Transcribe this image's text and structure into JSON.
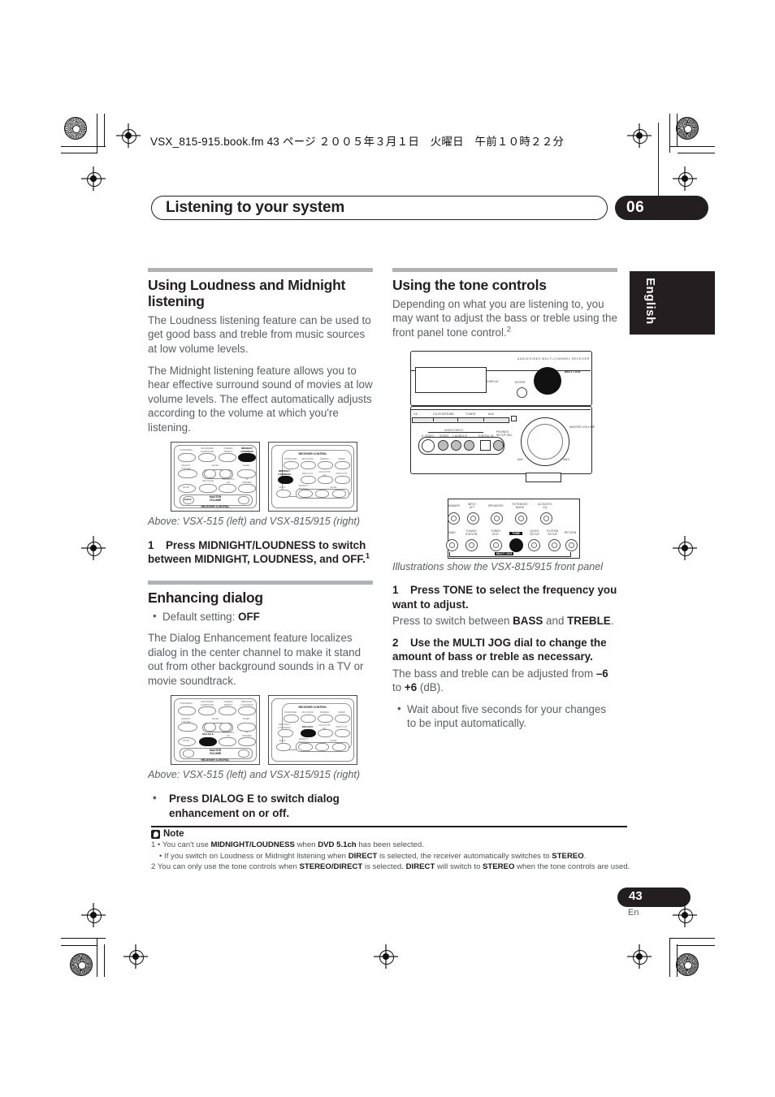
{
  "print_header": {
    "filename_line": "VSX_815-915.book.fm  43 ページ  ２００５年３月１日　火曜日　午前１０時２２分"
  },
  "chapter": {
    "title": "Listening to your system",
    "number": "06"
  },
  "language_tab": "English",
  "left_column": {
    "section1": {
      "heading": "Using Loudness and Midnight listening",
      "paragraphs": [
        "The Loudness listening feature can be used to get good bass and treble from music sources at low volume levels.",
        "The Midnight listening feature allows you to hear effective surround sound of movies at low volume levels. The effect automatically adjusts according to the volume at which you're listening."
      ],
      "figure_caption": "Above: VSX-515 (left) and VSX-815/915 (right)",
      "step_number": "1",
      "step_text_a": "Press MIDNIGHT/LOUDNESS to switch between MIDNIGHT, LOUDNESS, and OFF.",
      "step_footnote": "1"
    },
    "section2": {
      "heading": "Enhancing dialog",
      "bullet_default": "Default setting: ",
      "bullet_default_value": "OFF",
      "paragraph": "The Dialog Enhancement feature localizes dialog in the center channel to make it stand out from other background sounds in a TV or movie soundtrack.",
      "figure_caption": "Above: VSX-515 (left) and VSX-815/915 (right)",
      "bullet_step": "Press DIALOG E to switch dialog enhancement on or off."
    }
  },
  "right_column": {
    "section": {
      "heading": "Using the tone controls",
      "intro_a": "Depending on what you are listening to, you may want to adjust the bass or treble using the front panel tone control.",
      "intro_footnote": "2",
      "figure_caption": "Illustrations show the VSX-815/915 front panel",
      "step1_number": "1",
      "step1_text": "Press TONE to select the frequency you want to adjust.",
      "step1_body_a": "Press to switch between ",
      "step1_body_bold1": "BASS",
      "step1_body_b": " and ",
      "step1_body_bold2": "TREBLE",
      "step1_body_c": ".",
      "step2_number": "2",
      "step2_text": "Use the MULTI JOG dial to change the amount of bass or treble as necessary.",
      "step2_body_a": "The bass and treble can be adjusted from ",
      "step2_body_bold1": "–6",
      "step2_body_b": " to ",
      "step2_body_bold2": "+6",
      "step2_body_c": " (dB).",
      "step2_bullet": "Wait about five seconds for your changes to be input automatically."
    }
  },
  "note_block": {
    "title": "Note",
    "items": [
      {
        "index": "1",
        "bullet": "•",
        "parts": [
          "You can't use ",
          "MIDNIGHT/LOUDNESS",
          " when ",
          "DVD 5.1ch",
          " has been selected."
        ]
      },
      {
        "index": "",
        "bullet": "•",
        "parts": [
          "If you switch on Loudness or Midnight listening when ",
          "DIRECT",
          " is selected, the receiver automatically switches to ",
          "STEREO",
          "."
        ]
      },
      {
        "index": "2",
        "bullet": "",
        "parts": [
          "You can only use the tone controls when ",
          "STEREO/DIRECT",
          " is selected. ",
          "DIRECT",
          " will switch to ",
          "STEREO",
          " when the tone controls are used."
        ]
      }
    ]
  },
  "footer": {
    "page_number": "43",
    "language_code": "En"
  },
  "illustrations": {
    "remote_515": {
      "name": "VSX-515 remote receiver control area",
      "bottom_label": "RECEIVER CONTROL",
      "buttons": [
        "STANDARD",
        "ADVANCED SURROUND",
        "STEREO DIRECT",
        "MIDNIGHT LOUDNESS",
        "EFFECT TON SEL",
        "LEVEL",
        "–",
        "+",
        "SLEEP",
        "DIALOG E",
        "ACOUSTIC EQ",
        "TV DIMMER",
        "MUTE"
      ],
      "master_volume_label": "MASTER VOLUME",
      "master_minus": "–",
      "master_plus": "+"
    },
    "remote_815": {
      "name": "VSX-815/915 remote receiver control area",
      "top_label": "RECEIVER CONTROL",
      "buttons": [
        "STANDARD",
        "ADV.SURR",
        "STEREO",
        "SLEEP",
        "MIDNIGHT LOUDNESS",
        "DIALOG E",
        "ACOUSTIC EQ",
        "INPUT ATT",
        "SHIFT",
        "EFFECT TON SEL",
        "LEVEL",
        "–",
        "+"
      ]
    },
    "front_panel": {
      "name": "VSX-815/915 front panel",
      "title_text": "AUDIO/VIDEO  MULTI-CHANNEL  RECEIVER",
      "multi_jog_label": "MULTI JOG",
      "enter_label": "ENTER",
      "master_volume_label": "MASTER VOLUME",
      "input_row": [
        "CD",
        "CD-R/TAPE/MD",
        "TUNER",
        "AUX"
      ],
      "video_input_label": "VIDEO INPUT",
      "video_input_jacks": [
        "S-VIDEO",
        "VIDEO",
        "L  AUDIO  R",
        "DIGITAL IN"
      ],
      "phones_label": "PHONES",
      "setup_mic_label": "SETUP MIC"
    },
    "detail_panel": {
      "name": "front panel button detail",
      "row1": [
        "DIMMER",
        "INPUT ATT",
        "SPEAKERS",
        "EXTENDED MODE",
        "ACOUSTIC EQ"
      ],
      "row2": [
        "BAND",
        "TUNING STATION",
        "TUNER EDIT",
        "TONE",
        "QUICK SETUP",
        "SYSTEM SETUP",
        "RETURN"
      ],
      "highlighted_button": "TONE",
      "bracket_label": "MULTI JOG"
    }
  },
  "colors": {
    "ink": "#231f20",
    "body_gray": "#5b5e60",
    "rule_gray": "#b0b2b4",
    "paper": "#ffffff"
  }
}
